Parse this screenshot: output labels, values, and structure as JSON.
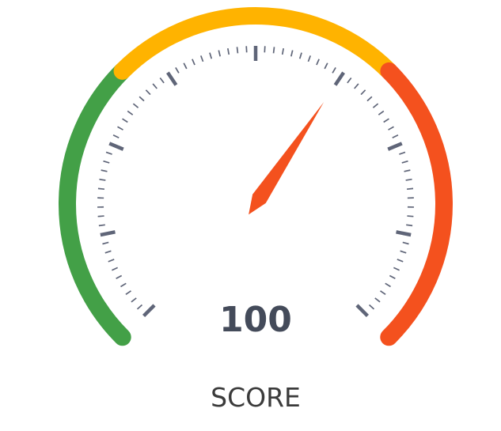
{
  "chart_data": {
    "type": "gauge",
    "value": 100,
    "value_label": "100",
    "label": "SCORE",
    "min": 0,
    "max": 160,
    "bands": [
      {
        "from": 0,
        "to": 53.3,
        "color": "#43a047"
      },
      {
        "from": 53.3,
        "to": 106.7,
        "color": "#ffb300"
      },
      {
        "from": 106.7,
        "to": 160,
        "color": "#f4511e"
      }
    ],
    "needle_color": "#f4511e",
    "tick_color": "#5f6578"
  }
}
